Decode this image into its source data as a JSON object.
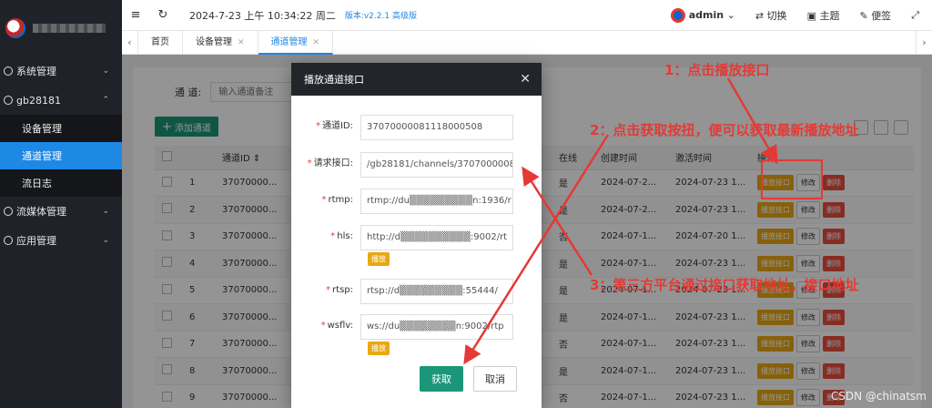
{
  "sidebar": {
    "menus": [
      {
        "label": "系统管理",
        "chev": "⌄"
      },
      {
        "label": "gb28181",
        "chev": "⌃"
      }
    ],
    "sub_items": [
      "设备管理",
      "通道管理",
      "流日志"
    ],
    "menus2": [
      {
        "label": "流媒体管理",
        "chev": "⌄"
      },
      {
        "label": "应用管理",
        "chev": "⌄"
      }
    ]
  },
  "topbar": {
    "time": "2024-7-23 上午 10:34:22 周二",
    "version": "版本:v2.2.1 高级版",
    "user": "admin",
    "switch": "切换",
    "theme": "主题",
    "note": "便签"
  },
  "tabs": [
    {
      "label": "首页"
    },
    {
      "label": "设备管理"
    },
    {
      "label": "通道管理"
    }
  ],
  "filter": {
    "label": "通 道:",
    "placeholder": "输入通道备注"
  },
  "add_button": "添加通道",
  "table": {
    "headers": [
      "",
      "",
      "通道ID",
      "在线",
      "创建时间",
      "激活时间",
      "操作"
    ],
    "rows": [
      {
        "n": "1",
        "id": "37070000...",
        "online": "是",
        "created": "2024-07-2...",
        "active": "2024-07-23 1..."
      },
      {
        "n": "2",
        "id": "37070000...",
        "online": "是",
        "created": "2024-07-2...",
        "active": "2024-07-23 1..."
      },
      {
        "n": "3",
        "id": "37070000...",
        "online": "否",
        "created": "2024-07-1...",
        "active": "2024-07-20 1..."
      },
      {
        "n": "4",
        "id": "37070000...",
        "online": "是",
        "created": "2024-07-1...",
        "active": "2024-07-23 1..."
      },
      {
        "n": "5",
        "id": "37070000...",
        "online": "是",
        "created": "2024-07-1...",
        "active": "2024-07-23 1..."
      },
      {
        "n": "6",
        "id": "37070000...",
        "online": "是",
        "created": "2024-07-1...",
        "active": "2024-07-23 1..."
      },
      {
        "n": "7",
        "id": "37070000...",
        "online": "否",
        "created": "2024-07-1...",
        "active": "2024-07-23 1..."
      },
      {
        "n": "8",
        "id": "37070000...",
        "online": "是",
        "created": "2024-07-1...",
        "active": "2024-07-23 1..."
      },
      {
        "n": "9",
        "id": "37070000...",
        "online": "否",
        "created": "2024-07-1...",
        "active": "2024-07-23 1..."
      }
    ],
    "op_play": "播放接口",
    "op_edit": "修改",
    "op_delete": "删除"
  },
  "dialog": {
    "title": "播放通道接口",
    "fields": [
      {
        "label": "通道ID:",
        "value": "37070000081118000508"
      },
      {
        "label": "请求接口:",
        "value": "/gb28181/channels/37070000081"
      },
      {
        "label": "rtmp:",
        "value": "rtmp://du▒▒▒▒▒▒▒▒▒n:1936/r"
      },
      {
        "label": "hls:",
        "value": "http://d▒▒▒▒▒▒▒▒▒▒:9002/rt"
      },
      {
        "label": "rtsp:",
        "value": "rtsp://d▒▒▒▒▒▒▒▒▒:55444/"
      },
      {
        "label": "wsflv:",
        "value": "ws://du▒▒▒▒▒▒▒▒n:9002/rtp"
      }
    ],
    "play_tag": "播放",
    "get_button": "获取",
    "cancel_button": "取消"
  },
  "annotations": {
    "step1": "1：点击播放接口",
    "step2": "2：点击获取按扭，便可以获取最新播放地址",
    "step3": "3：第三方平台通过接口获取地址，接口地址"
  },
  "watermark": "CSDN @chinatsm",
  "colors": {
    "accent": "#1e88e5",
    "primary_green": "#1b9678",
    "warn": "#e8a812",
    "danger": "#e84c3d",
    "annotation": "#e53935"
  }
}
